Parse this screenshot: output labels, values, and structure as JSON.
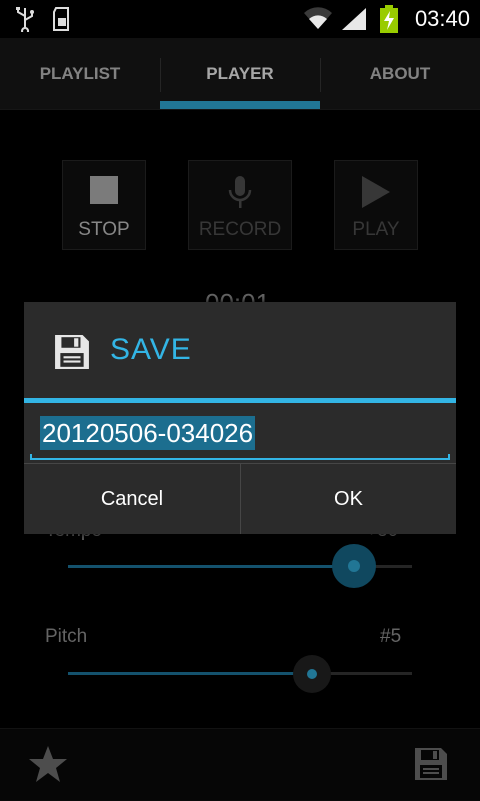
{
  "status_bar": {
    "time": "03:40",
    "icons": [
      "usb-icon",
      "sd-card-icon",
      "wifi-icon",
      "signal-icon",
      "battery-charging-icon"
    ]
  },
  "tabs": [
    {
      "label": "PLAYLIST",
      "selected": false
    },
    {
      "label": "PLAYER",
      "selected": true
    },
    {
      "label": "ABOUT",
      "selected": false
    }
  ],
  "controls": {
    "stop": "STOP",
    "record": "RECORD",
    "play": "PLAY"
  },
  "timer": "00:01",
  "sliders": {
    "tempo": {
      "label": "Tempo",
      "value_text": "+30",
      "level": 0.95
    },
    "pitch": {
      "label": "Pitch",
      "value_text": "#5",
      "level": 0.71
    }
  },
  "dialog": {
    "title": "SAVE",
    "icon": "floppy-disk-icon",
    "input_value": "20120506-034026",
    "cancel": "Cancel",
    "ok": "OK"
  },
  "bottom_bar": {
    "icons": [
      "star-icon",
      "save-icon"
    ]
  },
  "colors": {
    "accent": "#33b5e5",
    "background": "#000000",
    "dialog_bg": "#2b2b2b"
  }
}
